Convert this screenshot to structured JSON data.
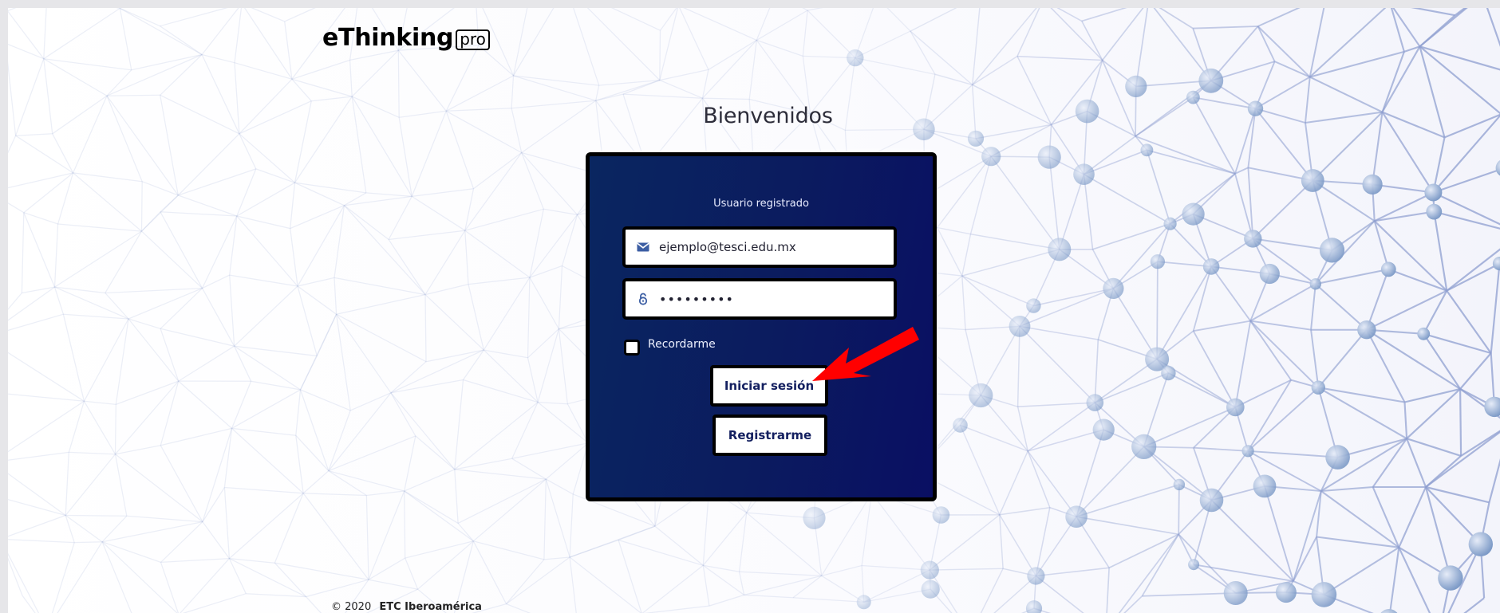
{
  "brand": {
    "name": "eThinking",
    "suffix": "pro"
  },
  "welcome": "Bienvenidos",
  "login": {
    "subtitle": "Usuario registrado",
    "email": {
      "value": "ejemplo@tesci.edu.mx",
      "icon": "envelope-icon"
    },
    "password": {
      "value": "•••••••••",
      "icon": "lock-icon"
    },
    "remember_label": "Recordarme",
    "login_button": "Iniciar sesión",
    "register_button": "Registrarme"
  },
  "annotation": {
    "type": "arrow",
    "color": "#ff0000"
  },
  "footer": {
    "copyright": "© 2020",
    "company": "ETC Iberoamérica"
  },
  "colors": {
    "card_background": "#0b1b5f",
    "button_text": "#142060",
    "network": "#8f9fd0"
  }
}
